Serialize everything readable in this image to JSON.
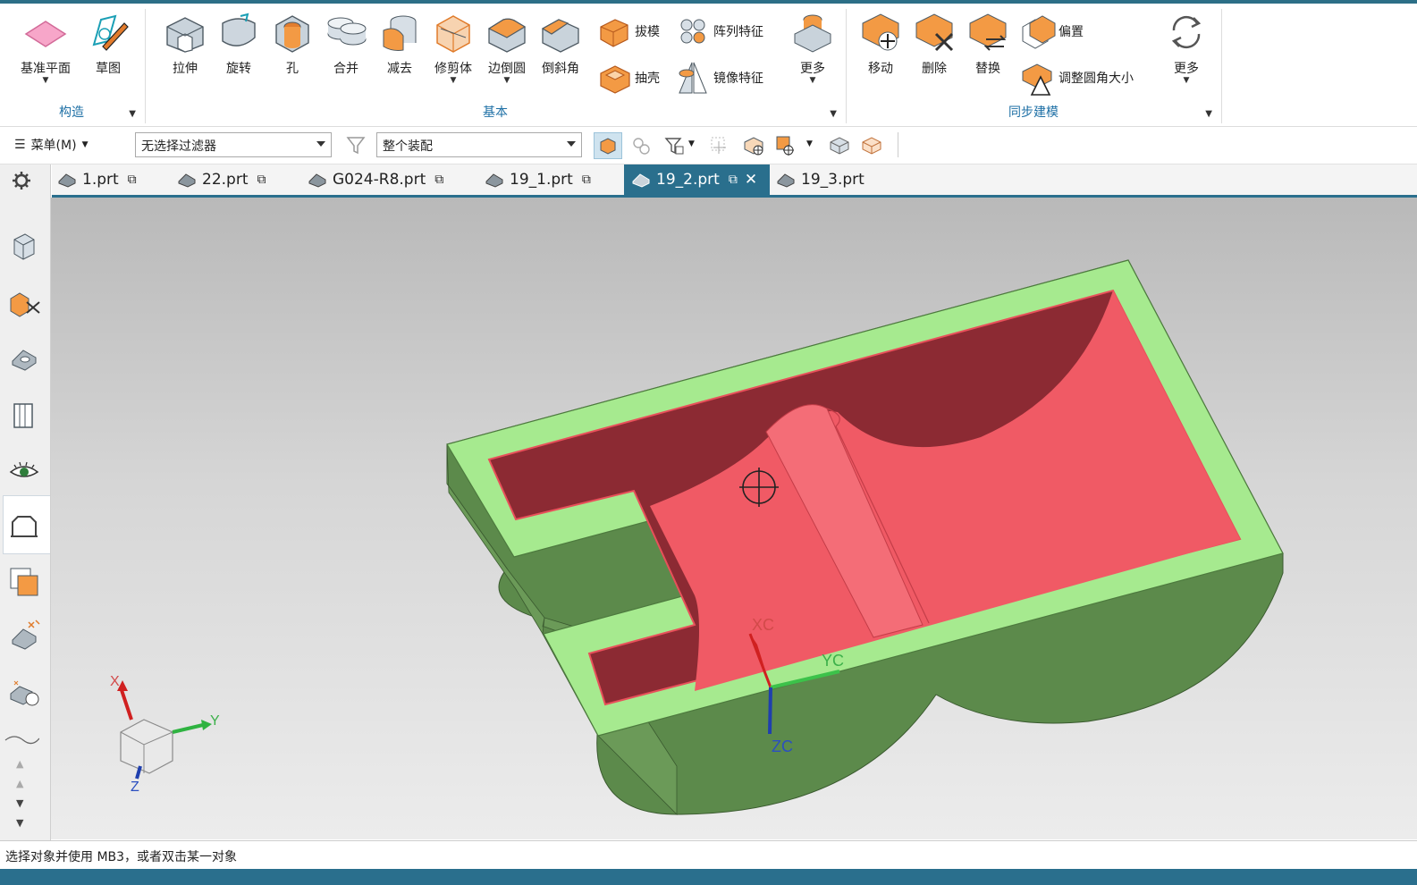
{
  "ribbon": {
    "construct": {
      "label": "构造",
      "tools": [
        {
          "label": "基准平面",
          "icon": "datum-plane-icon"
        },
        {
          "label": "草图",
          "icon": "sketch-icon"
        }
      ]
    },
    "basic": {
      "label": "基本",
      "tools": [
        {
          "label": "拉伸"
        },
        {
          "label": "旋转"
        },
        {
          "label": "孔"
        },
        {
          "label": "合并"
        },
        {
          "label": "减去"
        },
        {
          "label": "修剪体"
        },
        {
          "label": "边倒圆"
        },
        {
          "label": "倒斜角"
        }
      ],
      "small_tools": [
        {
          "label": "拔模"
        },
        {
          "label": "阵列特征"
        },
        {
          "label": "抽壳"
        },
        {
          "label": "镜像特征"
        }
      ],
      "more": "更多"
    },
    "sync": {
      "label": "同步建模",
      "tools": [
        {
          "label": "移动"
        },
        {
          "label": "删除"
        },
        {
          "label": "替换"
        }
      ],
      "small_tools": [
        {
          "label": "偏置"
        },
        {
          "label": "调整圆角大小"
        }
      ],
      "more": "更多"
    }
  },
  "toolbar": {
    "menu_label": "菜单(M)",
    "filter_value": "无选择过滤器",
    "scope_value": "整个装配"
  },
  "tabs": [
    {
      "label": "1.prt",
      "active": false
    },
    {
      "label": "22.prt",
      "active": false
    },
    {
      "label": "G024-R8.prt",
      "active": false
    },
    {
      "label": "19_1.prt",
      "active": false
    },
    {
      "label": "19_2.prt",
      "active": true
    },
    {
      "label": "19_3.prt",
      "active": false
    }
  ],
  "viewport": {
    "wcs": {
      "x": "XC",
      "y": "YC",
      "z": "ZC"
    },
    "triad": {
      "x": "X",
      "y": "Y",
      "z": "Z"
    },
    "colors": {
      "outer": "#5f8d4e",
      "rim": "#a6ea8f",
      "cavity": "#e8505a",
      "cavity_dark": "#8c2a33"
    }
  },
  "status": {
    "text": "选择对象并使用 MB3，或者双击某一对象"
  }
}
